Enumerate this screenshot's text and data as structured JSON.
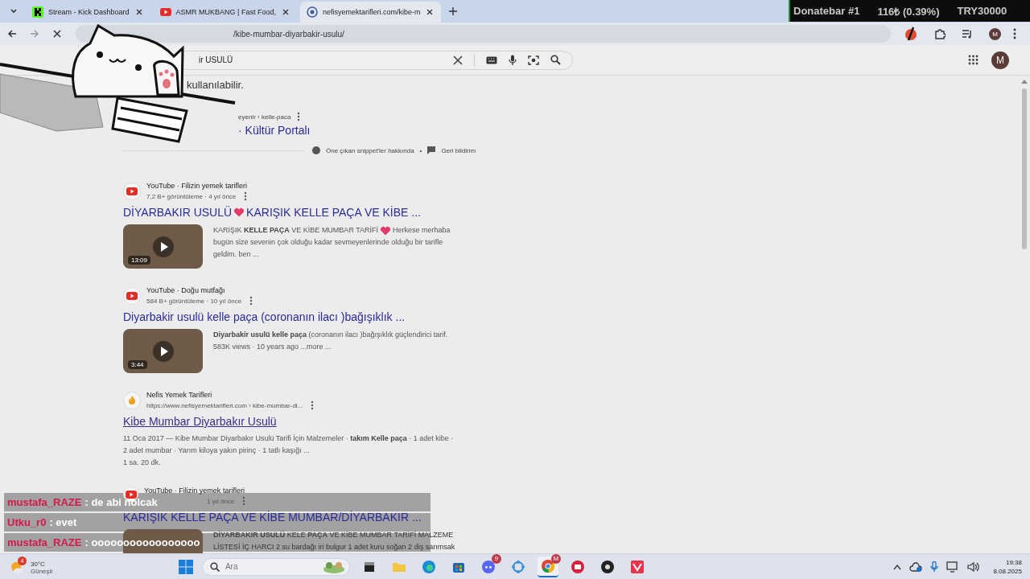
{
  "tabs": [
    {
      "title": "Stream - Kick Dashboard",
      "kind": "kick",
      "selected": false
    },
    {
      "title": "ASMR MUKBANG | Fast Food,",
      "kind": "youtube",
      "selected": false
    },
    {
      "title": "nefisyemektarifleri.com/kibe-m",
      "kind": "globe",
      "selected": true
    }
  ],
  "donatebar": {
    "title": "Donatebar #1",
    "amount": "116₺ (0.39%)",
    "goal": "TRY30000"
  },
  "address_bar": {
    "url": "/kibe-mumbar-diyarbakir-usulu/"
  },
  "toolbar_avatar": "M",
  "search": {
    "value": "ir USULÜ"
  },
  "google_avatar": "M",
  "featured": {
    "text": "kullanılabilir.",
    "breadcrumb": "eyenir › kelle-paca",
    "site": "· Kültür Portalı",
    "about": "Öne çıkan snippet'ler hakkında",
    "separator": "•",
    "feedback": "Geri bildirim"
  },
  "results": [
    {
      "kind": "video",
      "source": "YouTube · Filizin yemek tarifleri",
      "meta": "7,2 B+ görüntüleme · 4 yıl önce",
      "title": [
        "DİYARBAKIR USULÜ ",
        {
          "kind": "heart"
        },
        "KARIŞIK KELLE PAÇA VE KİBE ..."
      ],
      "duration": "13:09",
      "snippet": [
        [
          "KARIŞIK **KELLE PAÇA** VE KİBE MUMBAR TARİFİ ",
          {
            "kind": "heart"
          },
          "Herkese merhaba"
        ],
        [
          "bugün size sevenin çok olduğu kadar sevmeyenlerinde olduğu bir tarifle"
        ],
        [
          "geldim. ben ..."
        ]
      ]
    },
    {
      "kind": "video",
      "source": "YouTube · Doğu mutfağı",
      "meta": "584 B+ görüntüleme · 10 yıl önce",
      "title": [
        "Diyarbakir usulü kelle paça (coronanın ilacı )bağışıklık ..."
      ],
      "duration": "3:44",
      "snippet": [
        [
          "**Diyarbakir usulü kelle paça** (coronanın ilacı )bağışıklık güçlendirici tarif."
        ],
        [
          "583K views · 10 years ago ...more ..."
        ]
      ]
    },
    {
      "kind": "page",
      "source": "Nefis Yemek Tarifleri",
      "meta": "https://www.nefisyemektarifleri.com › kibe-mumbar-di...",
      "title": [
        "Kibe Mumbar Diyarbakır Usulü"
      ],
      "snippet": [
        [
          "11 Oca 2017 — Kibe Mumbar Diyarbakır Usulü Tarifi İçin Malzemeler · **takım Kelle paça** · 1 adet kibe ·"
        ],
        [
          "2 adet mumbar · Yarım kiloya yakın pirinç · 1 tatlı kaşığı ..."
        ],
        [
          "1 sa. 20 dk."
        ]
      ]
    },
    {
      "kind": "video",
      "source": "YouTube · Filizin yemek tarifleri",
      "meta": "1 yıl önce",
      "title": [
        "KARIŞIK KELLE PAÇA VE KİBE MUMBAR/DİYARBAKIR ..."
      ],
      "snippet": [
        [
          "**DİYARBAKIR USULÜ** KELE **PAÇA** VE KİBE MUMBAR TARİFİ MALZEME"
        ],
        [
          "LİSTESİ İÇ HARCI 2 su bardağı iri bulgur 1 adet kuru soğan 2 diş sarımsak"
        ]
      ]
    }
  ],
  "chat": [
    {
      "user": "mustafa_RAZE",
      "text": ": de abi nolcak"
    },
    {
      "user": "Utku_r0",
      "text": ": evet"
    },
    {
      "user": "mustafa_RAZE",
      "text": ": ooooooooooooooooo"
    }
  ],
  "taskbar": {
    "weather": {
      "badge": "4",
      "temperature": "30°C",
      "condition": "Güneşli"
    },
    "search_placeholder": "Ara",
    "apps": [
      {
        "kind": "files",
        "selected": false
      },
      {
        "kind": "folder",
        "selected": false
      },
      {
        "kind": "edge",
        "selected": false
      },
      {
        "kind": "store",
        "selected": false
      },
      {
        "kind": "discord",
        "badge": "9",
        "selected": false
      },
      {
        "kind": "app",
        "selected": false
      },
      {
        "kind": "chrome",
        "badge": "M",
        "selected": true
      },
      {
        "kind": "red",
        "selected": false
      },
      {
        "kind": "obs",
        "selected": false
      },
      {
        "kind": "valorant",
        "selected": false
      }
    ],
    "time": "19:38",
    "date": "8.08.2025"
  }
}
